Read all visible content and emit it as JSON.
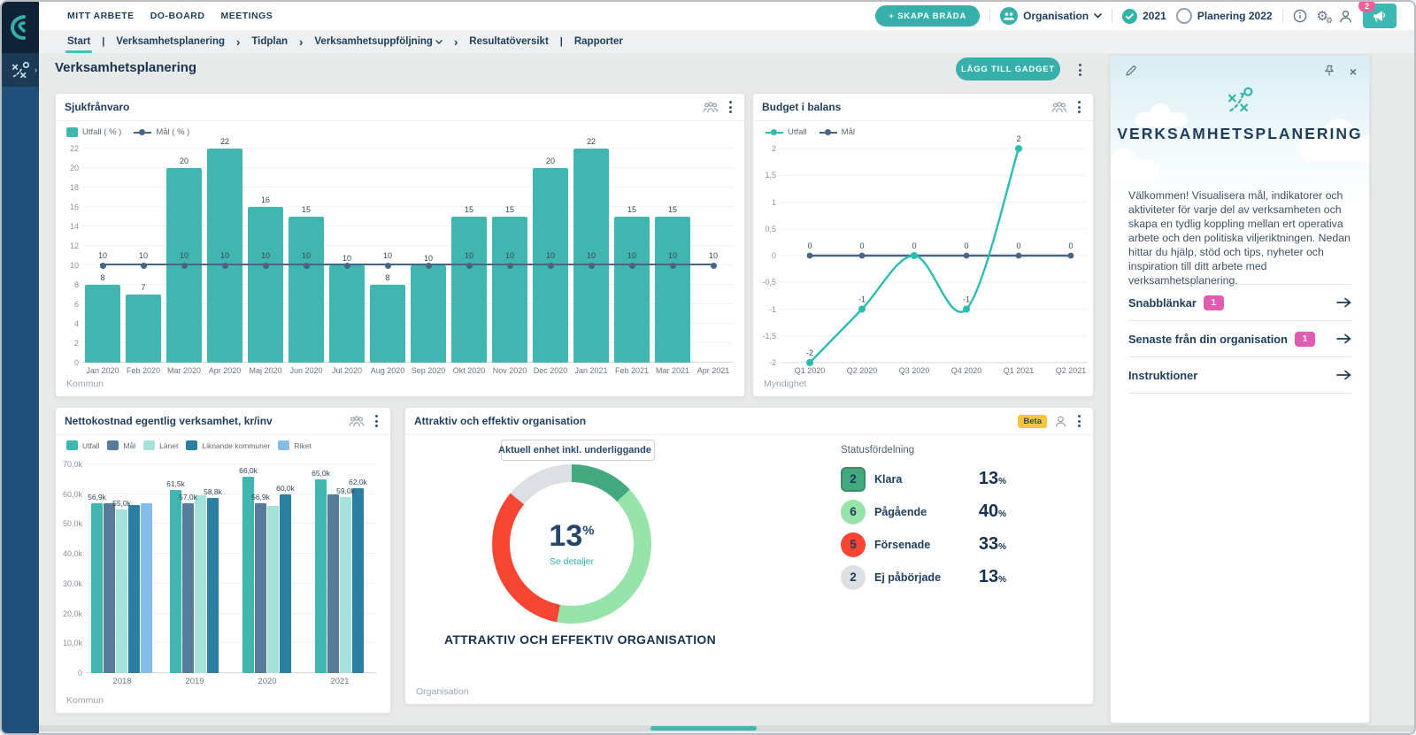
{
  "topbar": {
    "nav_items": [
      "MITT ARBETE",
      "DO-BOARD",
      "MEETINGS"
    ],
    "create_board_label": "+ SKAPA BRÄDA",
    "organisation_label": "Organisation",
    "year_selected": "2021",
    "year_planning": "Planering 2022",
    "notification_count": "2"
  },
  "breadcrumb": {
    "start": "Start",
    "verksamhetsplanering": "Verksamhetsplanering",
    "tidplan": "Tidplan",
    "verksamhetsuppfoljning": "Verksamhetsuppföljning",
    "resultatoversikt": "Resultatöversikt",
    "rapporter": "Rapporter"
  },
  "page": {
    "title": "Verksamhetsplanering",
    "add_gadget_label": "LÄGG TILL GADGET"
  },
  "chart_data": [
    {
      "type": "bar",
      "title": "Sjukfrånvaro",
      "legend": [
        {
          "label": "Utfall ( % )",
          "marker": "square",
          "color": "#41b6b0"
        },
        {
          "label": "Mål ( % )",
          "marker": "line",
          "color": "#476685"
        }
      ],
      "categories": [
        "Jan 2020",
        "Feb 2020",
        "Mar 2020",
        "Apr 2020",
        "Maj 2020",
        "Jun 2020",
        "Jul 2020",
        "Aug 2020",
        "Sep 2020",
        "Okt 2020",
        "Nov 2020",
        "Dec 2020",
        "Jan 2021",
        "Feb 2021",
        "Mar 2021",
        "Apr 2021"
      ],
      "values": [
        8,
        7,
        20,
        22,
        16,
        15,
        10,
        8,
        10,
        15,
        15,
        20,
        22,
        15,
        15,
        null
      ],
      "goal": 10,
      "ylim": [
        0,
        22
      ],
      "ytick_step": 2,
      "footer": "Kommun"
    },
    {
      "type": "line",
      "title": "Budget i balans",
      "x": [
        "Q1 2020",
        "Q2 2020",
        "Q3 2020",
        "Q4 2020",
        "Q1 2021",
        "Q2 2021"
      ],
      "series": [
        {
          "name": "Utfall",
          "color": "#2cbdb2",
          "values": [
            -2,
            -1,
            0,
            -1,
            2,
            null
          ]
        },
        {
          "name": "Mål",
          "color": "#476685",
          "values": [
            0,
            0,
            0,
            0,
            0,
            0
          ]
        }
      ],
      "ylim": [
        -2,
        2
      ],
      "ytick_labels": [
        "2",
        "1,5",
        "1",
        "0,5",
        "0",
        "-0,5",
        "-1",
        "-1,5",
        "-2"
      ],
      "footer": "Myndighet"
    },
    {
      "type": "bar",
      "grouped": true,
      "title": "Nettokostnad egentlig verksamhet, kr/inv",
      "categories": [
        "2018",
        "2019",
        "2020",
        "2021"
      ],
      "series": [
        {
          "name": "Utfall",
          "color": "#41b6b0",
          "values": [
            56.9,
            61.5,
            66.0,
            65.0
          ],
          "labels": [
            "56,9k",
            "61,5k",
            "66,0k",
            "65,0k"
          ]
        },
        {
          "name": "Mål",
          "color": "#587b9a",
          "values": [
            57.0,
            57.0,
            56.9,
            60.0
          ],
          "labels": [
            null,
            "57,0k",
            "56,9k",
            null
          ]
        },
        {
          "name": "Länet",
          "color": "#a5e3da",
          "values": [
            55.0,
            59.5,
            56.2,
            59.0
          ],
          "labels": [
            "55,0k",
            null,
            null,
            "59,0k"
          ]
        },
        {
          "name": "Liknande kommuner",
          "color": "#2b7fa0",
          "values": [
            56.3,
            58.8,
            60.0,
            62.0
          ],
          "labels": [
            null,
            "58,8k",
            "60,0k",
            "62,0k"
          ]
        },
        {
          "name": "Riket",
          "color": "#85bce8",
          "values": [
            56.9,
            null,
            null,
            null
          ],
          "labels": [
            null,
            null,
            null,
            null
          ]
        }
      ],
      "ylim": [
        0,
        70
      ],
      "ytick_labels": [
        "0",
        "10,0k",
        "20,0k",
        "30,0k",
        "40,0k",
        "50,0k",
        "60,0k",
        "70,0k"
      ],
      "footer": "Kommun"
    },
    {
      "type": "pie",
      "title": "Attraktiv och effektiv organisation",
      "beta_label": "Beta",
      "dropdown_value": "Aktuell enhet inkl. underliggande",
      "center_value": "13",
      "center_unit": "%",
      "details_link": "Se detaljer",
      "caption": "ATTRAKTIV OCH EFFEKTIV ORGANISATION",
      "status_heading": "Statusfördelning",
      "segments": [
        {
          "label": "Klara",
          "count": "2",
          "pct": 13,
          "color": "#42a97e",
          "badge": "square"
        },
        {
          "label": "Pågående",
          "count": "6",
          "pct": 40,
          "color": "#97e3aa",
          "badge": "circle"
        },
        {
          "label": "Försenade",
          "count": "5",
          "pct": 33,
          "color": "#f64532",
          "badge": "circle"
        },
        {
          "label": "Ej påbörjade",
          "count": "2",
          "pct": 13,
          "color": "#dce0e5",
          "badge": "circle"
        }
      ],
      "footer": "Organisation"
    }
  ],
  "panel": {
    "title": "VERKSAMHETSPLANERING",
    "welcome_text": "Välkommen! Visualisera mål, indikatorer och aktiviteter för varje del av verksamheten och skapa en tydlig koppling mellan ert operativa arbete och den politiska viljeriktningen. Nedan hittar du hjälp, stöd och tips, nyheter och inspiration till ditt arbete med verksamhetsplanering.",
    "links": [
      {
        "label": "Snabblänkar",
        "badge": "1"
      },
      {
        "label": "Senaste från din organisation",
        "badge": "1"
      },
      {
        "label": "Instruktioner",
        "badge": null
      }
    ]
  },
  "colors": {
    "accent_teal": "#41b6b0",
    "navy": "#1d3d5c",
    "panel_badge_pink": "#e05cb0",
    "notification_pink": "#ee5f9f",
    "beta_yellow": "#f8c63e"
  }
}
